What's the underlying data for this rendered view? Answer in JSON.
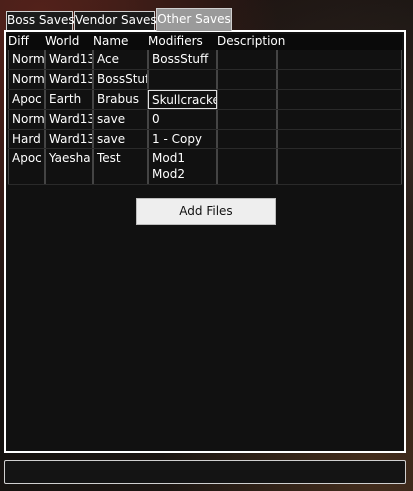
{
  "tabs": [
    {
      "label": "Boss Saves"
    },
    {
      "label": "Vendor Saves"
    },
    {
      "label": "Other Saves"
    }
  ],
  "table": {
    "columns": [
      "Diff",
      "World",
      "Name",
      "Modifiers",
      "Description"
    ],
    "rows": [
      {
        "diff": "Norm",
        "world": "Ward13",
        "name": "Ace",
        "modifiers": "BossStuff",
        "description": ""
      },
      {
        "diff": "Norm",
        "world": "Ward13",
        "name": "BossStuff",
        "modifiers": "",
        "description": ""
      },
      {
        "diff": "Apoc",
        "world": "Earth",
        "name": "Brabus",
        "modifiers": "Skullcracker",
        "description": ""
      },
      {
        "diff": "Norm",
        "world": "Ward13",
        "name": "save",
        "modifiers": "0",
        "description": ""
      },
      {
        "diff": "Hard",
        "world": "Ward13",
        "name": "save",
        "modifiers": "1 - Copy",
        "description": ""
      },
      {
        "diff": "Apoc",
        "world": "Yaesha",
        "name": "Test",
        "modifiers": "Mod1\nMod2",
        "description": ""
      }
    ]
  },
  "add_files_label": "Add Files",
  "status_text": ""
}
